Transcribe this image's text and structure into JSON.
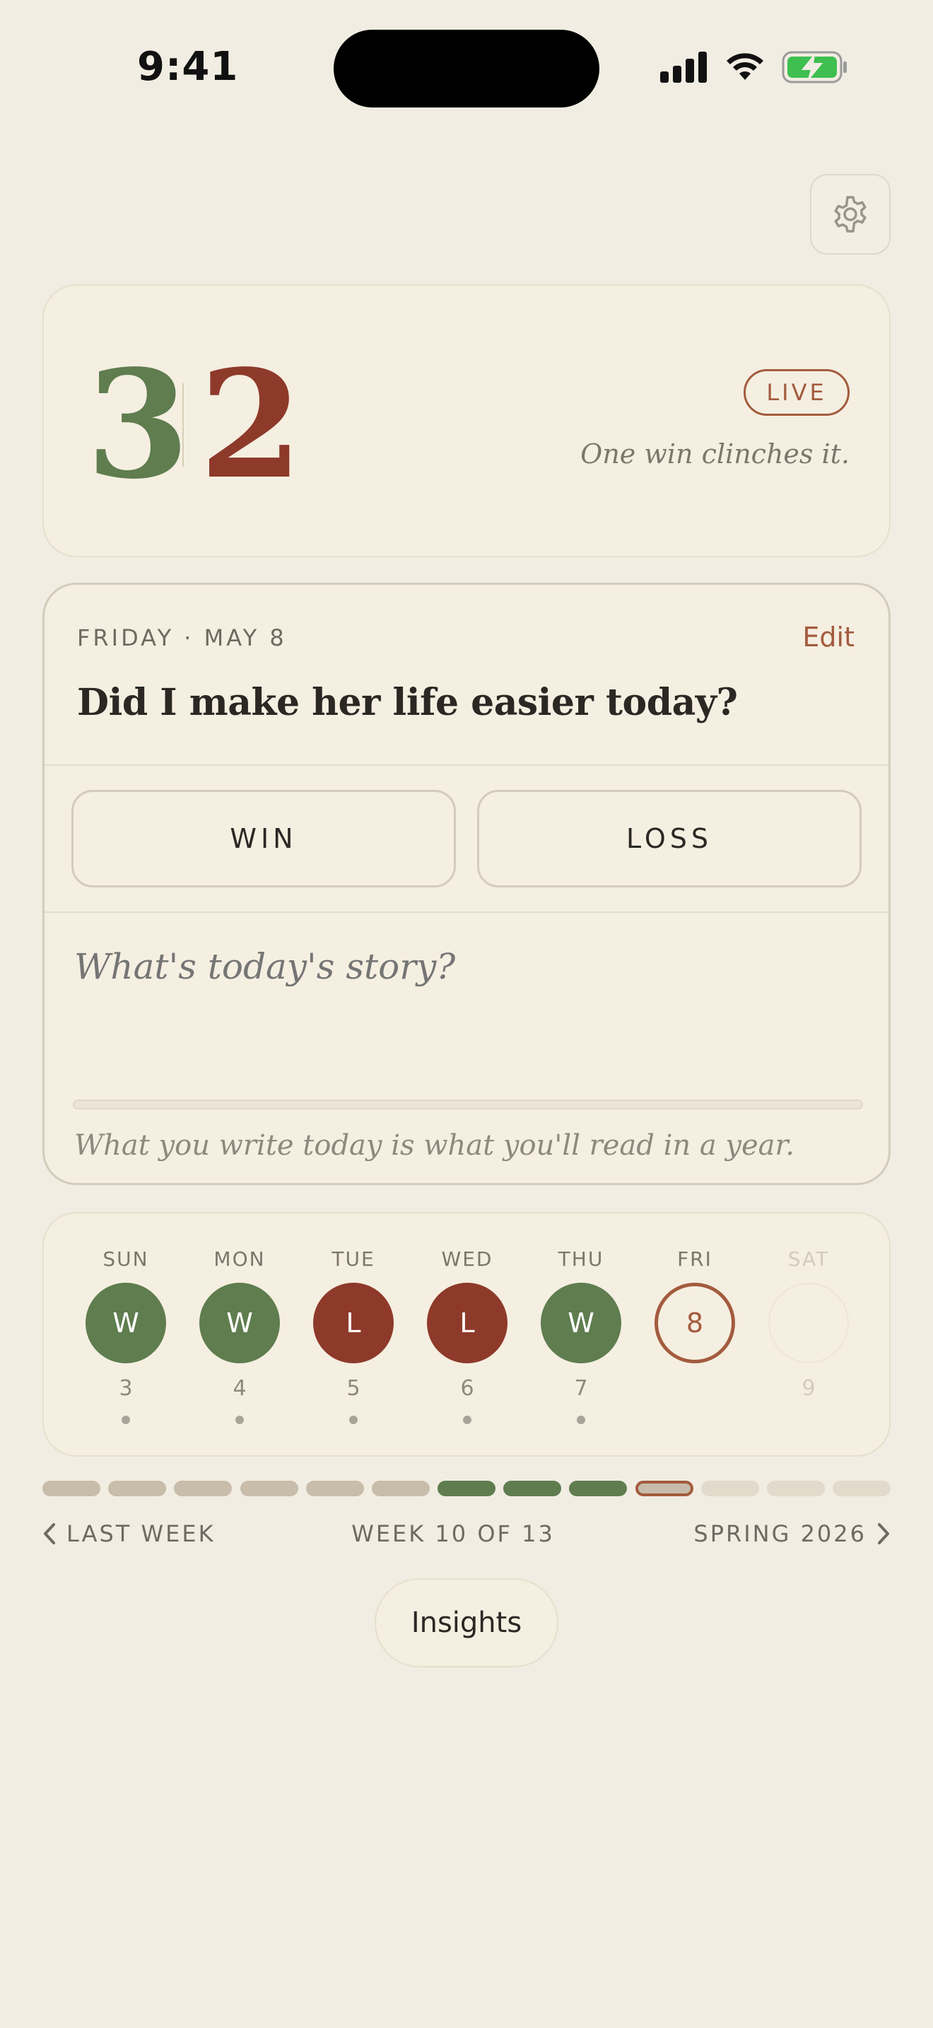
{
  "status_bar": {
    "time": "9:41"
  },
  "score": {
    "wins": "3",
    "losses": "2",
    "badge": "LIVE",
    "subtitle": "One win clinches it.",
    "win_color": "#5f7d4f",
    "loss_color": "#8e3a2a"
  },
  "today": {
    "date_label": "FRIDAY · MAY 8",
    "edit_label": "Edit",
    "question": "Did I make her life easier today?",
    "win_label": "WIN",
    "loss_label": "LOSS",
    "story_placeholder": "What's today's story?",
    "footer_hint": "What you write today is what you'll read in a year."
  },
  "week": {
    "days": [
      {
        "name": "SUN",
        "result": "W",
        "date": "3",
        "state": "win",
        "has_entry": true
      },
      {
        "name": "MON",
        "result": "W",
        "date": "4",
        "state": "win",
        "has_entry": true
      },
      {
        "name": "TUE",
        "result": "L",
        "date": "5",
        "state": "loss",
        "has_entry": true
      },
      {
        "name": "WED",
        "result": "L",
        "date": "6",
        "state": "loss",
        "has_entry": true
      },
      {
        "name": "THU",
        "result": "W",
        "date": "7",
        "state": "win",
        "has_entry": true
      },
      {
        "name": "FRI",
        "result": "8",
        "date": "",
        "state": "today",
        "has_entry": false
      },
      {
        "name": "SAT",
        "result": "",
        "date": "9",
        "state": "future",
        "has_entry": false
      }
    ]
  },
  "season": {
    "total_weeks": 13,
    "current_week": 10,
    "week_states": [
      "past",
      "past",
      "past",
      "past",
      "past",
      "past",
      "win",
      "win",
      "win",
      "current",
      "future",
      "future",
      "future"
    ],
    "prev_label": "LAST WEEK",
    "week_label": "WEEK 10 OF 13",
    "next_label": "SPRING 2026"
  },
  "insights_label": "Insights",
  "icons": {
    "settings": "gear-icon",
    "prev": "chevron-left-icon",
    "next": "chevron-right-icon"
  }
}
